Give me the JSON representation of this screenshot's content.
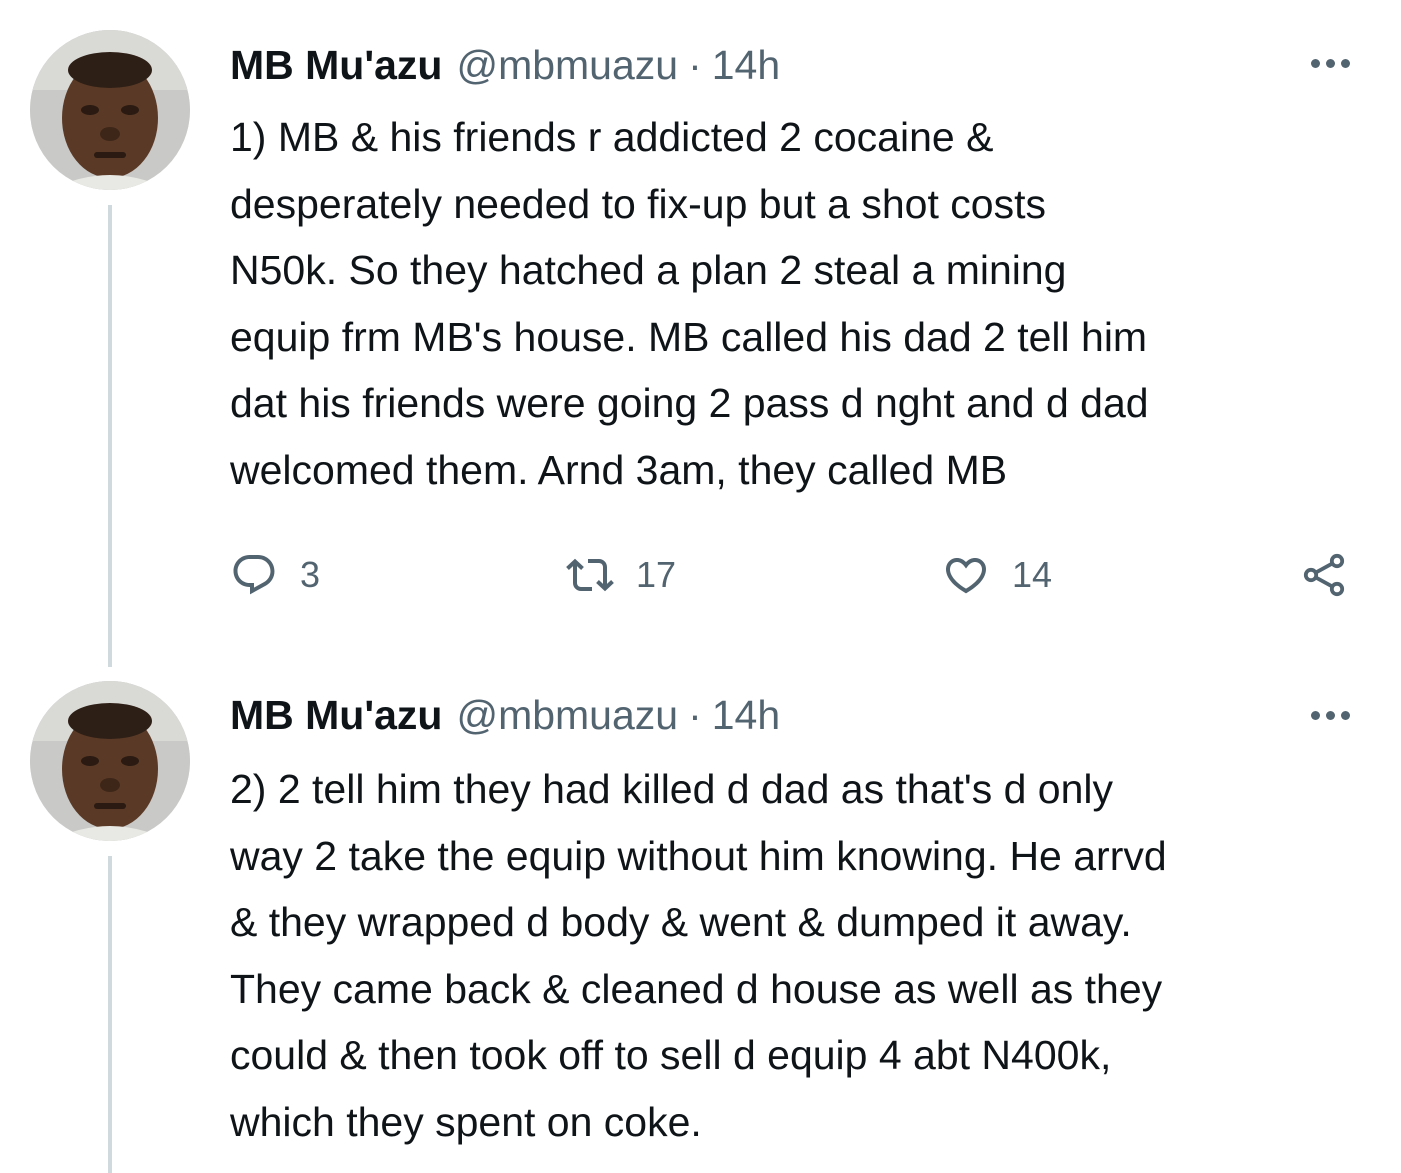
{
  "tweets": [
    {
      "author_name": "MB Mu'azu",
      "handle": "@mbmuazu",
      "separator": "·",
      "time": "14h",
      "text": "1)  MB & his friends r addicted 2 cocaine &\ndesperately needed to fix-up but a shot costs\nN50k. So they hatched a plan 2 steal a mining\nequip frm MB's house. MB called his dad 2 tell him\ndat his friends were going 2 pass d nght and d dad\nwelcomed them. Arnd 3am, they called MB",
      "reply_count": "3",
      "retweet_count": "17",
      "like_count": "14",
      "avatar_icon": "user-avatar",
      "more_icon": "more-options-icon"
    },
    {
      "author_name": "MB Mu'azu",
      "handle": "@mbmuazu",
      "separator": "·",
      "time": "14h",
      "text": "2) 2 tell him they had killed d dad as that's d only\nway 2 take the equip without him knowing. He arrvd\n& they wrapped d body & went & dumped it away.\nThey came back & cleaned d house as well as they\ncould & then took off to sell d equip 4 abt N400k,\nwhich they spent on coke.",
      "avatar_icon": "user-avatar",
      "more_icon": "more-options-icon"
    }
  ],
  "icons": {
    "reply": "reply-icon",
    "retweet": "retweet-icon",
    "like": "heart-icon",
    "share": "share-icon"
  },
  "colors": {
    "text_primary": "#0f1419",
    "text_secondary": "#536471",
    "thread_line": "#cfd9de",
    "background": "#ffffff"
  }
}
